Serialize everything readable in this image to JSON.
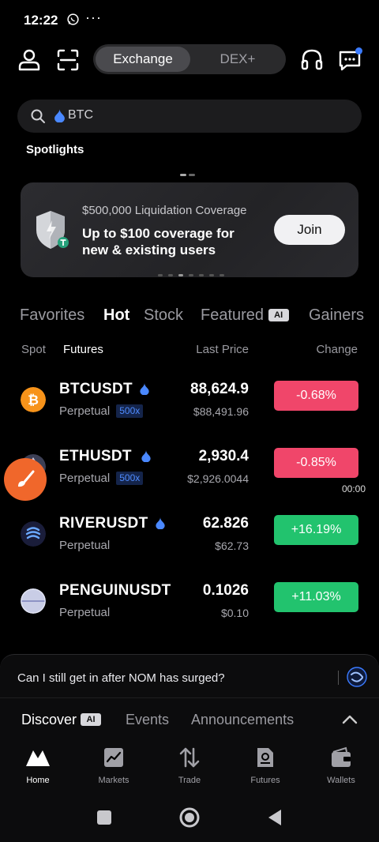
{
  "status": {
    "time": "12:22",
    "more": "···"
  },
  "header": {
    "segments": [
      "Exchange",
      "DEX+"
    ],
    "active_segment": "Exchange"
  },
  "search": {
    "value": "BTC"
  },
  "spotlights": {
    "title": "Spotlights"
  },
  "banner": {
    "subtitle": "$500,000 Liquidation Coverage",
    "headline": "Up to $100 coverage for new & existing users",
    "cta": "Join"
  },
  "market_tabs": {
    "favorites": "Favorites",
    "hot": "Hot",
    "stock": "Stock",
    "featured": "Featured",
    "gainers": "Gainers",
    "ai_badge": "AI"
  },
  "columns": {
    "spot": "Spot",
    "futures": "Futures",
    "last_price": "Last Price",
    "change": "Change"
  },
  "rows": [
    {
      "symbol": "BTCUSDT",
      "type": "Perpetual",
      "leverage": "500x",
      "price": "88,624.9",
      "fiat": "$88,491.96",
      "change": "-0.68%",
      "direction": "down"
    },
    {
      "symbol": "ETHUSDT",
      "type": "Perpetual",
      "leverage": "500x",
      "price": "2,930.4",
      "fiat": "$2,926.0044",
      "change": "-0.85%",
      "direction": "down"
    },
    {
      "symbol": "RIVERUSDT",
      "type": "Perpetual",
      "price": "62.826",
      "fiat": "$62.73",
      "change": "+16.19%",
      "direction": "up"
    },
    {
      "symbol": "PENGUINUSDT",
      "type": "Perpetual",
      "price": "0.1026",
      "fiat": "$0.10",
      "change": "+11.03%",
      "direction": "up"
    }
  ],
  "overlay": {
    "timer": "00:00"
  },
  "assistant": {
    "question": "Can I still get in after NOM has surged?"
  },
  "discover_tabs": {
    "discover": "Discover",
    "events": "Events",
    "announcements": "Announcements",
    "ai_badge": "AI"
  },
  "nav": {
    "items": [
      "Home",
      "Markets",
      "Trade",
      "Futures",
      "Wallets"
    ],
    "active": "Home"
  },
  "colors": {
    "negative": "#f0466a",
    "positive": "#22c36e",
    "accent": "#3b7bff",
    "fab": "#f0672b"
  }
}
